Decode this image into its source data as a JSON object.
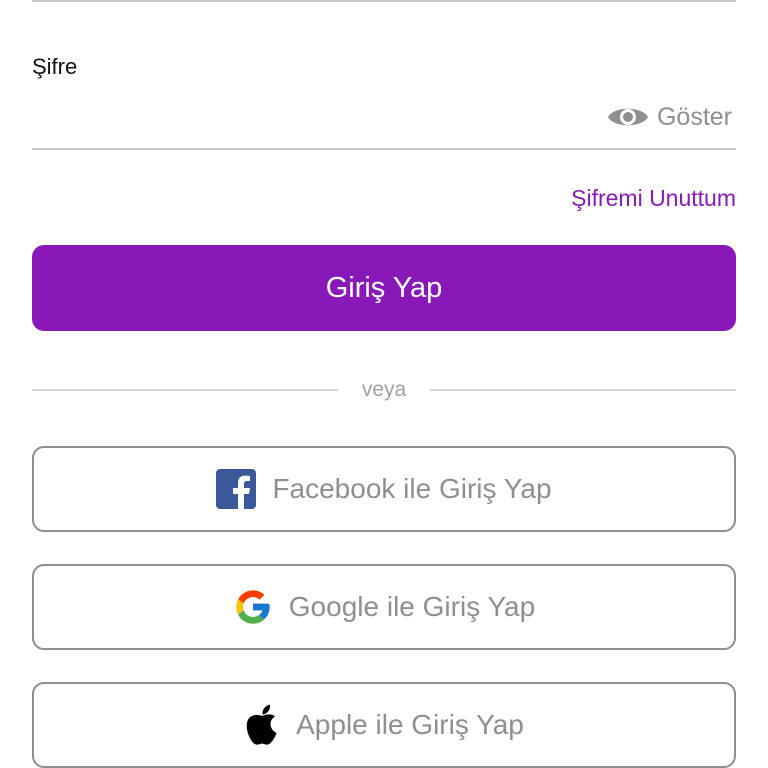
{
  "password": {
    "label": "Şifre",
    "value": "",
    "show_label": "Göster",
    "show_icon": "eye-icon"
  },
  "forgot_password": {
    "label": "Şifremi Unuttum"
  },
  "login_button": {
    "label": "Giriş Yap"
  },
  "divider": {
    "label": "veya"
  },
  "social": {
    "facebook": {
      "label": "Facebook ile Giriş Yap",
      "icon": "facebook-icon"
    },
    "google": {
      "label": "Google ile Giriş Yap",
      "icon": "google-icon"
    },
    "apple": {
      "label": "Apple ile Giriş Yap",
      "icon": "apple-icon"
    }
  },
  "colors": {
    "accent": "#8818b8",
    "link": "#8a19b8",
    "muted_text": "#8e8e93",
    "divider": "#c8c8c8",
    "facebook_blue": "#3b5998"
  }
}
